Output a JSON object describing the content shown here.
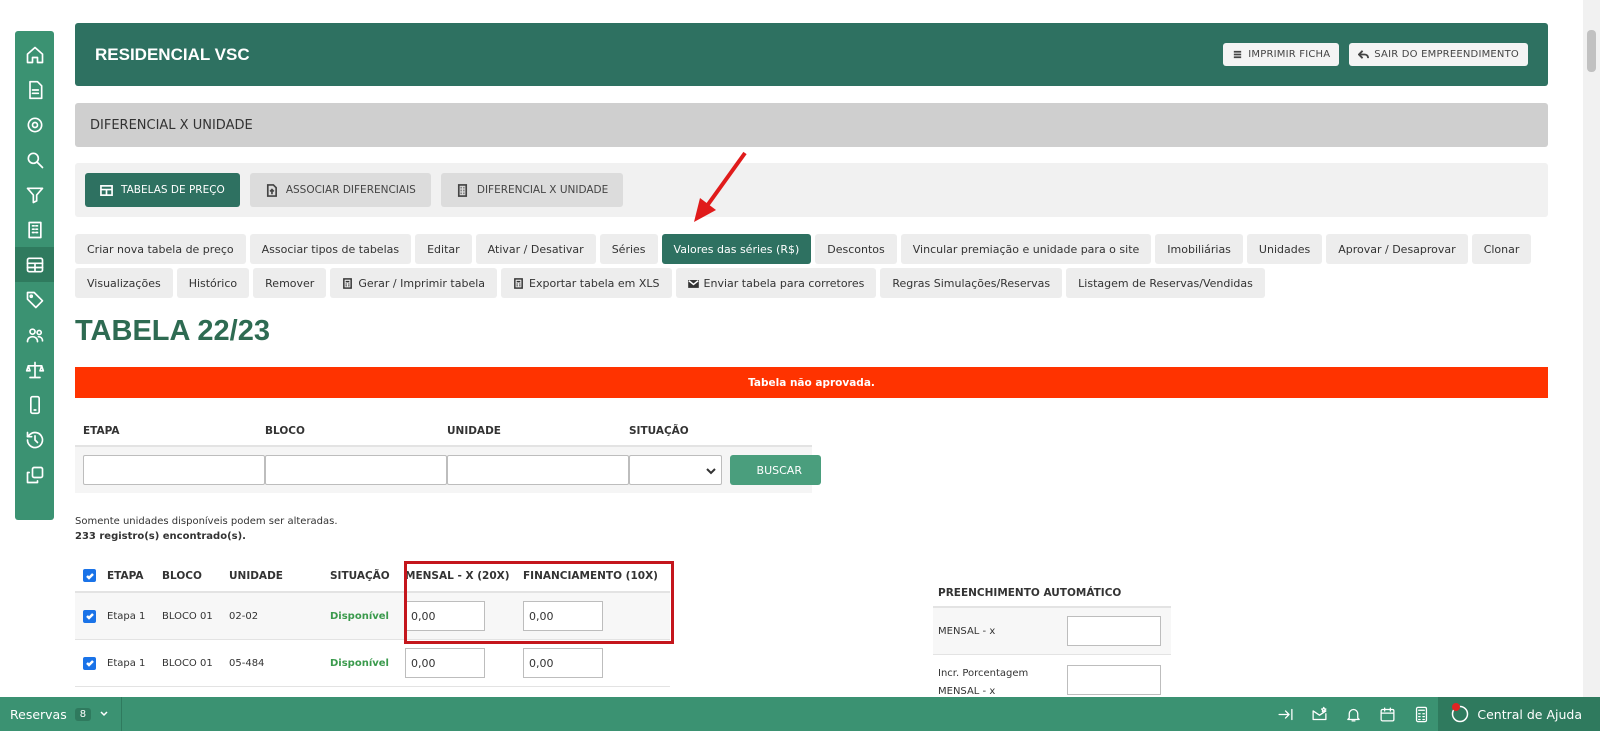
{
  "header": {
    "title": "RESIDENCIAL VSC",
    "print_label": "IMPRIMIR FICHA",
    "exit_label": "SAIR DO EMPREENDIMENTO"
  },
  "section": {
    "title": "DIFERENCIAL X UNIDADE"
  },
  "tabs": [
    {
      "label": "TABELAS DE PREÇO",
      "icon": "table-icon"
    },
    {
      "label": "ASSOCIAR DIFERENCIAIS",
      "icon": "file-upload-icon"
    },
    {
      "label": "DIFERENCIAL X UNIDADE",
      "icon": "building-icon"
    }
  ],
  "actions": [
    "Criar nova tabela de preço",
    "Associar tipos de tabelas",
    "Editar",
    "Ativar / Desativar",
    "Séries",
    "Valores das séries (R$)",
    "Descontos",
    "Vincular premiação e unidade para o site",
    "Imobiliárias",
    "Unidades",
    "Aprovar / Desaprovar",
    "Clonar",
    "Visualizações",
    "Histórico",
    "Remover",
    "Gerar / Imprimir tabela",
    "Exportar tabela em XLS",
    "Enviar tabela para corretores",
    "Regras Simulações/Reservas",
    "Listagem de Reservas/Vendidas"
  ],
  "page_title": "TABELA 22/23",
  "alert": "Tabela não aprovada.",
  "filter": {
    "etapa": "ETAPA",
    "bloco": "BLOCO",
    "unidade": "UNIDADE",
    "situacao": "SITUAÇÃO",
    "search": "BUSCAR"
  },
  "notes": {
    "line1": "Somente unidades disponíveis podem ser alteradas.",
    "line2": "233 registro(s) encontrado(s)."
  },
  "table": {
    "headers": {
      "etapa": "ETAPA",
      "bloco": "BLOCO",
      "unidade": "UNIDADE",
      "situacao": "SITUAÇÃO",
      "mensal": "MENSAL - X (20X)",
      "financiamento": "FINANCIAMENTO (10X)"
    },
    "rows": [
      {
        "etapa": "Etapa 1",
        "bloco": "BLOCO 01",
        "unidade": "02-02",
        "situacao": "Disponível",
        "mensal": "0,00",
        "financiamento": "0,00"
      },
      {
        "etapa": "Etapa 1",
        "bloco": "BLOCO 01",
        "unidade": "05-484",
        "situacao": "Disponível",
        "mensal": "0,00",
        "financiamento": "0,00"
      }
    ]
  },
  "auto": {
    "title": "PREENCHIMENTO AUTOMÁTICO",
    "row1": "MENSAL - x",
    "row2a": "Incr. Porcentagem",
    "row2b": "MENSAL - x"
  },
  "bottombar": {
    "reservas": "Reservas",
    "reservas_count": "8",
    "help": "Central de Ajuda"
  },
  "colors": {
    "brand": "#2e7161",
    "rail": "#3b9272",
    "alert": "#ff3300",
    "highlight": "#c4161c"
  }
}
